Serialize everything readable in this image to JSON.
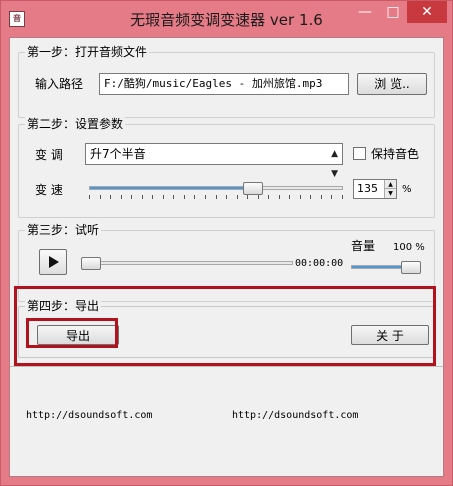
{
  "window": {
    "title": "无瑕音频变调变速器 ver 1.6",
    "icon": "音",
    "minimize": "—",
    "maximize": "□",
    "close": "✕"
  },
  "step1": {
    "title": "第一步：打开音频文件",
    "path_label": "输入路径",
    "path_value": "F:/酷狗/music/Eagles - 加州旅馆.mp3",
    "browse_label": "浏 览.."
  },
  "step2": {
    "title": "第二步：设置参数",
    "pitch_label": "变 调",
    "pitch_value": "升7个半音",
    "keep_timbre_label": "保持音色",
    "keep_timbre_checked": false,
    "speed_label": "变 速",
    "speed_value": "135",
    "speed_unit": "%",
    "speed_slider_fraction": 0.66
  },
  "step3": {
    "title": "第三步：试听",
    "time": "00:00:00",
    "volume_label": "音量",
    "volume_value": "100 %",
    "progress_fraction": 0,
    "volume_fraction": 1.0
  },
  "step4": {
    "title": "第四步：导出",
    "export_label": "导出",
    "about_label": "关 于"
  },
  "footer": {
    "link_left": "http://dsoundsoft.com",
    "link_right": "http://dsoundsoft.com"
  },
  "colors": {
    "accent_highlight": "#b1121d",
    "title_bar": "#e57b86"
  }
}
